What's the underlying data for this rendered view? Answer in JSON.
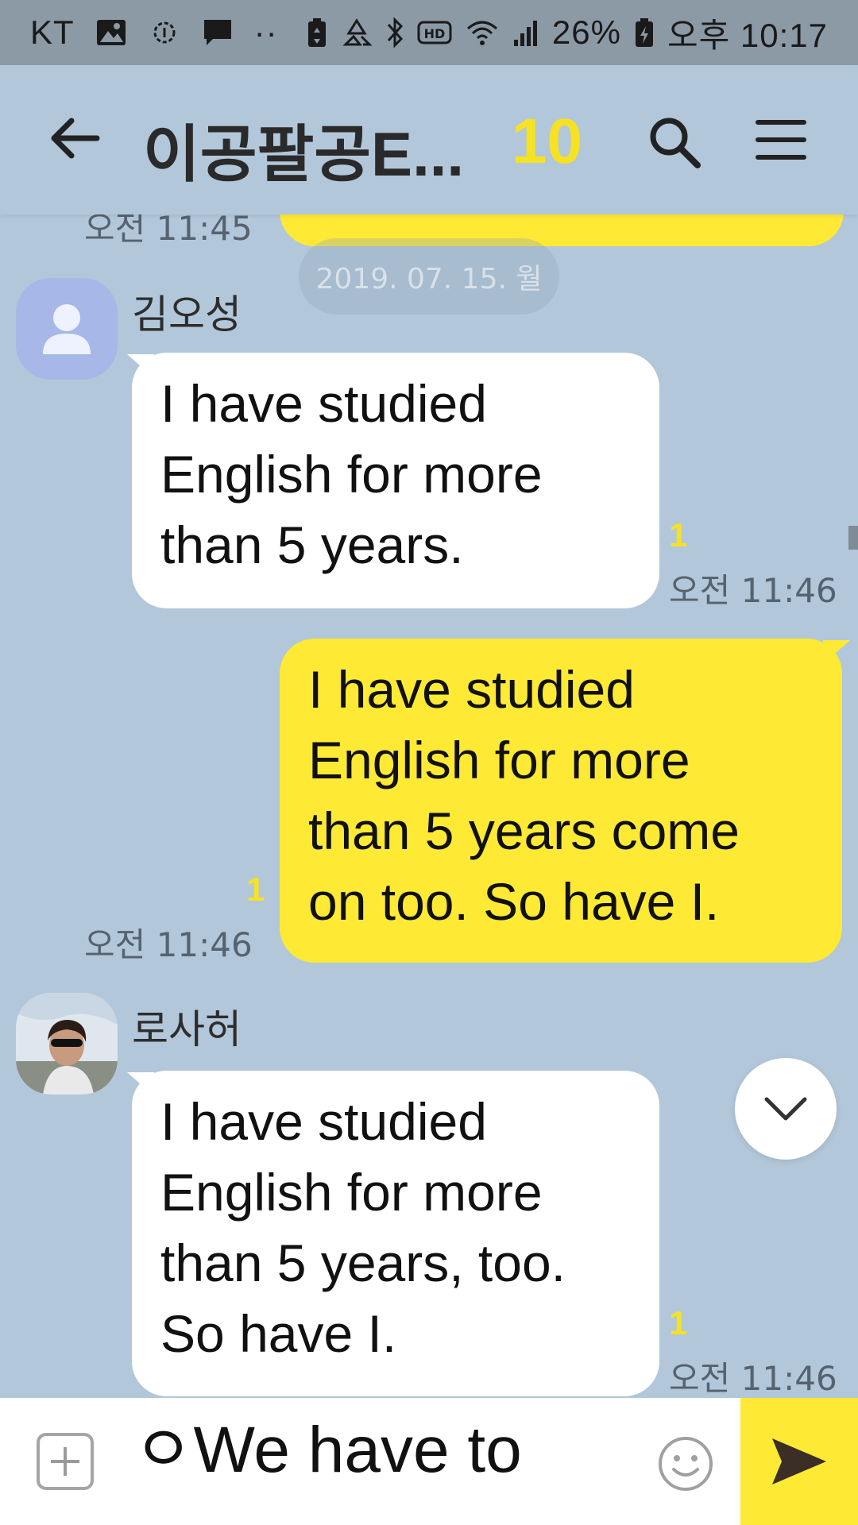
{
  "status_bar": {
    "carrier": "KT",
    "more_indicator": "··",
    "battery_percent": "26%",
    "time": "오후 10:17",
    "icons": [
      "image-icon",
      "chat-bubble-icon",
      "battery-saver-icon",
      "recycle-icon",
      "bluetooth-icon",
      "hd-icon",
      "wifi-icon",
      "signal-icon",
      "battery-icon"
    ]
  },
  "header": {
    "title": "이공팔공E...",
    "member_count": "10"
  },
  "date_divider": "2019. 07. 15. 월",
  "previous": {
    "time": "오전 11:45"
  },
  "messages": [
    {
      "sender": "김오성",
      "direction": "incoming",
      "lines": [
        "I have studied",
        "English for more",
        "than 5 years."
      ],
      "unread": "1",
      "time": "오전 11:46"
    },
    {
      "direction": "outgoing",
      "lines": [
        "I have studied",
        "English for more",
        "than 5 years come",
        "on too. So have I."
      ],
      "unread": "1",
      "time": "오전 11:46"
    },
    {
      "sender": "로사허",
      "direction": "incoming",
      "lines": [
        "I have studied",
        "English for more",
        "than 5 years, too.",
        "So have I."
      ],
      "unread": "1",
      "time": "오전 11:46"
    }
  ],
  "input": {
    "value": "ㅇWe have to"
  },
  "colors": {
    "background": "#b2c7d9",
    "outgoing_bubble": "#fee934",
    "incoming_bubble": "#ffffff",
    "unread_count": "#f6e223",
    "send_button": "#fee934"
  }
}
